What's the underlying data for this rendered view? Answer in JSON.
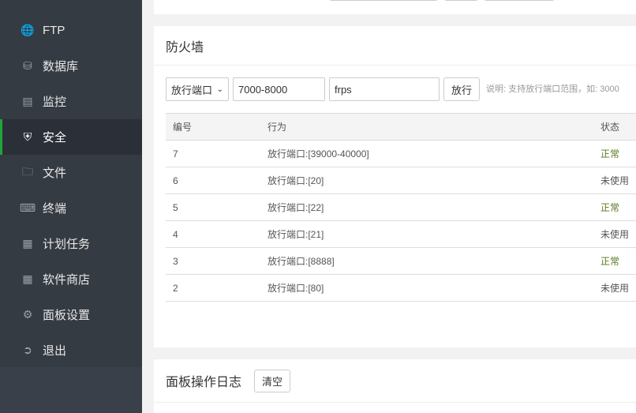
{
  "sidebar": {
    "items": [
      {
        "label": "FTP",
        "icon": "ftp-icon"
      },
      {
        "label": "数据库",
        "icon": "database-icon"
      },
      {
        "label": "监控",
        "icon": "monitor-icon"
      },
      {
        "label": "安全",
        "icon": "shield-icon",
        "active": true
      },
      {
        "label": "文件",
        "icon": "folder-icon"
      },
      {
        "label": "终端",
        "icon": "terminal-icon"
      },
      {
        "label": "计划任务",
        "icon": "calendar-icon"
      },
      {
        "label": "软件商店",
        "icon": "grid-icon"
      },
      {
        "label": "面板设置",
        "icon": "gear-icon"
      },
      {
        "label": "退出",
        "icon": "logout-icon"
      }
    ]
  },
  "firewall": {
    "title": "防火墙",
    "action_select": "放行端口",
    "port_value": "7000-8000",
    "remark_value": "frps",
    "submit_label": "放行",
    "note": "说明: 支持放行端口范围，如: 3000",
    "columns": [
      "编号",
      "行为",
      "状态"
    ],
    "rows": [
      {
        "id": "7",
        "action": "放行端口:[39000-40000]",
        "status": "正常"
      },
      {
        "id": "6",
        "action": "放行端口:[20]",
        "status": "未使用"
      },
      {
        "id": "5",
        "action": "放行端口:[22]",
        "status": "正常"
      },
      {
        "id": "4",
        "action": "放行端口:[21]",
        "status": "未使用"
      },
      {
        "id": "3",
        "action": "放行端口:[8888]",
        "status": "正常"
      },
      {
        "id": "2",
        "action": "放行端口:[80]",
        "status": "未使用"
      }
    ]
  },
  "log": {
    "title": "面板操作日志",
    "clear_label": "清空"
  },
  "colors": {
    "accent": "#20a53a",
    "sidebar": "#353b43"
  }
}
